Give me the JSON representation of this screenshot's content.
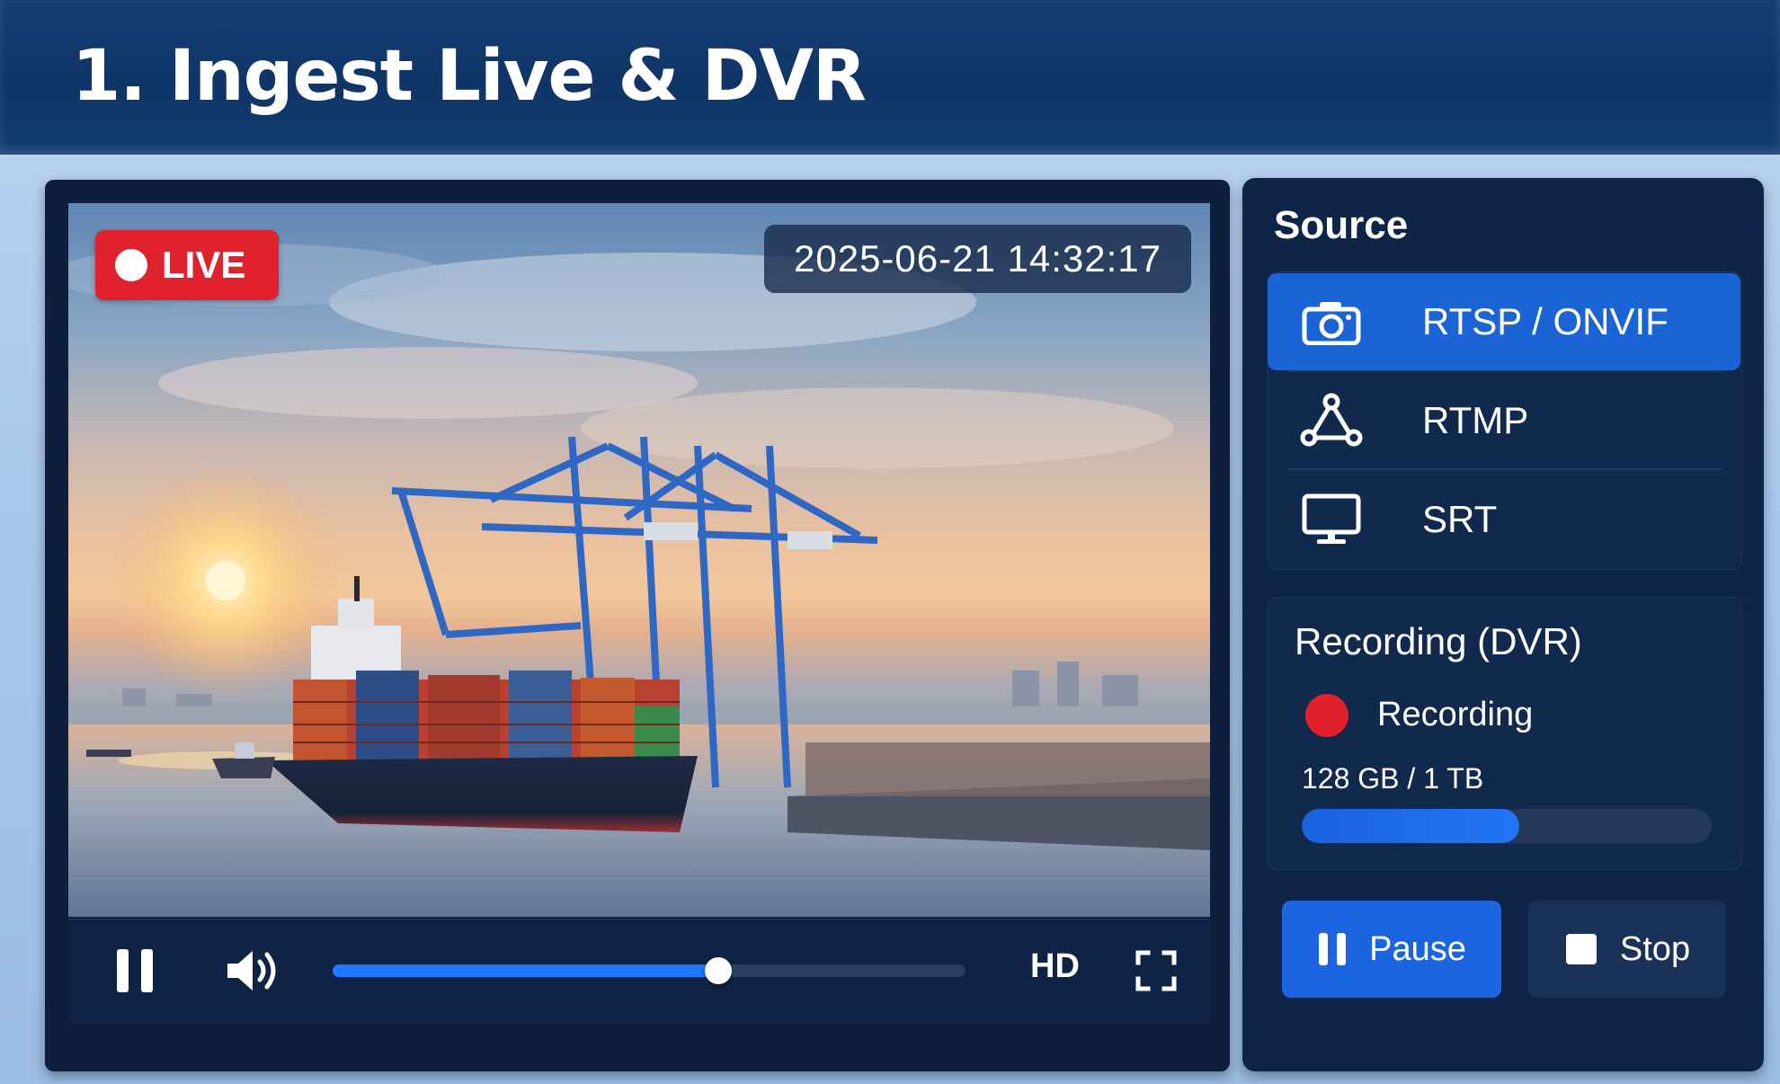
{
  "page": {
    "title": "1. Ingest Live & DVR"
  },
  "player": {
    "live_label": "LIVE",
    "timestamp": "2025-06-21 14:32:17",
    "quality_label": "HD",
    "seek_progress": 0.61,
    "scene": "container ship at port with cranes at sunset"
  },
  "source": {
    "title": "Source",
    "items": [
      {
        "label": "RTSP / ONVIF",
        "icon": "camera-icon",
        "active": true
      },
      {
        "label": "RTMP",
        "icon": "network-icon",
        "active": false
      },
      {
        "label": "SRT",
        "icon": "monitor-icon",
        "active": false
      }
    ]
  },
  "recording": {
    "title": "Recording (DVR)",
    "status": "Recording",
    "storage_text": "128 GB / 1 TB",
    "storage_fraction": 0.53
  },
  "buttons": {
    "pause_label": "Pause",
    "stop_label": "Stop"
  },
  "colors": {
    "accent": "#1b66e0",
    "live_red": "#e0222f",
    "panel": "#0f2547"
  }
}
